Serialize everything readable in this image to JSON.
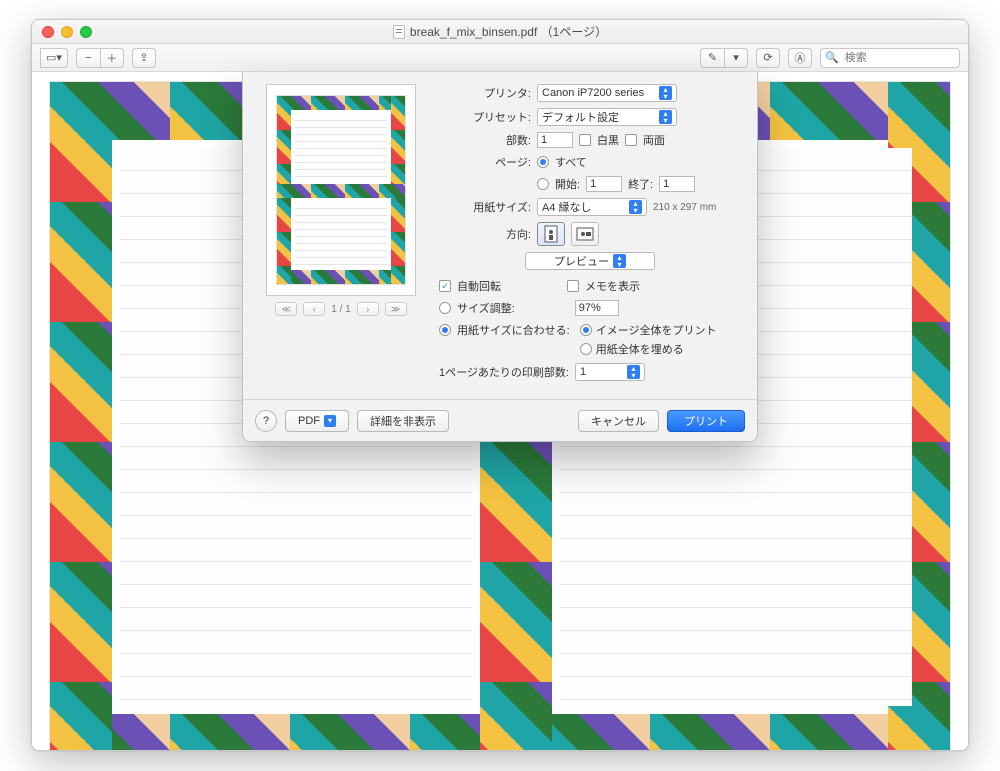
{
  "window": {
    "title_filename": "break_f_mix_binsen.pdf",
    "title_suffix": "（1ページ）"
  },
  "toolbar": {
    "search_placeholder": "検索"
  },
  "dialog": {
    "labels": {
      "printer": "プリンタ:",
      "preset": "プリセット:",
      "copies": "部数:",
      "bw": "白黒",
      "duplex": "両面",
      "pages": "ページ:",
      "all": "すべて",
      "from": "開始:",
      "to": "終了:",
      "paper_size": "用紙サイズ:",
      "orientation": "方向:",
      "preview_section": "プレビュー",
      "auto_rotate": "自動回転",
      "show_notes": "メモを表示",
      "scale_adjust": "サイズ調整:",
      "fit_paper": "用紙サイズに合わせる:",
      "print_whole_image": "イメージ全体をプリント",
      "fill_paper": "用紙全体を埋める",
      "copies_per_page": "1ページあたりの印刷部数:"
    },
    "values": {
      "printer": "Canon iP7200 series",
      "preset": "デフォルト設定",
      "copies": "1",
      "from": "1",
      "to": "1",
      "paper_size": "A4 縁なし",
      "paper_dim": "210 x 297 mm",
      "scale_pct": "97%",
      "copies_per_page": "1"
    },
    "pager": "1 / 1",
    "footer": {
      "help": "?",
      "pdf": "PDF",
      "hide_details": "詳細を非表示",
      "cancel": "キャンセル",
      "print": "プリント"
    }
  }
}
